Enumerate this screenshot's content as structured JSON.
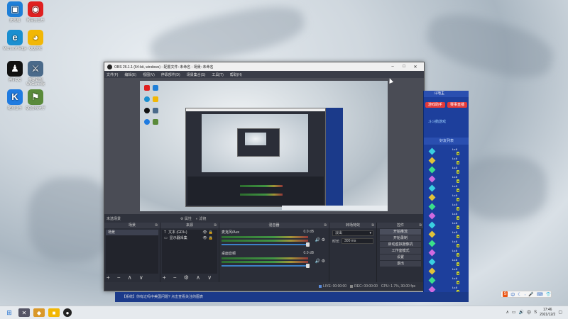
{
  "desktop": {
    "icons": [
      {
        "label": "此电脑",
        "icon": "computer-icon",
        "color": "#1e7fd8"
      },
      {
        "label": "网易云音乐",
        "icon": "netease-music-icon",
        "color": "#e02020"
      },
      {
        "label": "Microsoft Edge",
        "icon": "edge-icon",
        "color": "#1a8fd0"
      },
      {
        "label": "QQ游戏",
        "icon": "qq-game-icon",
        "color": "#f2b705"
      },
      {
        "label": "腾讯QQ",
        "icon": "qq-penguin-icon",
        "color": "#111111"
      },
      {
        "label": "英雄联盟 WeGame版",
        "icon": "wegame-icon",
        "color": "#4a6a8a"
      },
      {
        "label": "酷狗音乐",
        "icon": "kugou-icon",
        "color": "#1f7be0"
      },
      {
        "label": "QQ游戏大厅",
        "icon": "game-lobby-icon",
        "color": "#5a8a3a"
      }
    ]
  },
  "obs": {
    "title": "OBS 26.1.1 (64-bit, windows) - 配置文件: 未命名 - 场景: 未命名",
    "menu": [
      "文件(F)",
      "编辑(E)",
      "视图(V)",
      "停靠部件(D)",
      "场景集合(S)",
      "工具(T)",
      "帮助(H)"
    ],
    "scene_bar": {
      "scene_name": "未选场景",
      "filters_label": "属性",
      "settings_label": "滤镜"
    },
    "docks": {
      "scenes": {
        "header": "场景",
        "items": [
          "场景"
        ]
      },
      "sources": {
        "header": "来源",
        "items": [
          {
            "label": "文本 (GDI+)",
            "icon": "text-icon"
          },
          {
            "label": "显示器采集",
            "icon": "monitor-icon"
          }
        ]
      },
      "mixer": {
        "header": "混音器",
        "channels": [
          {
            "name": "麦克风/Aux",
            "level": "0.0 dB"
          },
          {
            "name": "桌面音频",
            "level": "0.0 dB"
          }
        ]
      },
      "transitions": {
        "header": "转场特效",
        "type": "淡出",
        "duration_label": "时长",
        "duration": "300 ms"
      },
      "controls": {
        "header": "控件",
        "buttons": [
          "开始推流",
          "开始录制",
          "启动虚拟摄像机",
          "工作室模式",
          "设置",
          "退出"
        ]
      }
    },
    "status": {
      "live": "LIVE: 00:00:00",
      "rec": "REC: 00:00:00",
      "cpu": "CPU: 1.7%, 30.00 fps"
    }
  },
  "game_panel": {
    "title": "斗地主",
    "btn_left": "游戏助手",
    "btn_right": "赛事直播",
    "section": "斗斗鹅游戏",
    "list_title": "好友列表",
    "rows": [
      "Lv.6",
      "Lv.6",
      "Lv.5",
      "Lv.6",
      "Lv.5",
      "Lv.6",
      "Lv.5",
      "Lv.6",
      "Lv.6",
      "Lv.5",
      "Lv.6",
      "Lv.6",
      "Lv.6",
      "Lv.5",
      "Lv.6",
      "Lv.6"
    ]
  },
  "ticker": {
    "text": "【系统】你有过吗中美国问题? 点击查看关注的图表"
  },
  "taskbar": {
    "time": "17:46",
    "date": "2021/12/2",
    "ime": "中",
    "tray_language": "中"
  },
  "colors": {
    "obs_bg": "#2b2e38",
    "game_blue": "#1d3f9c",
    "accent_red": "#e23a3a",
    "slider_blue": "#3c82c8"
  }
}
